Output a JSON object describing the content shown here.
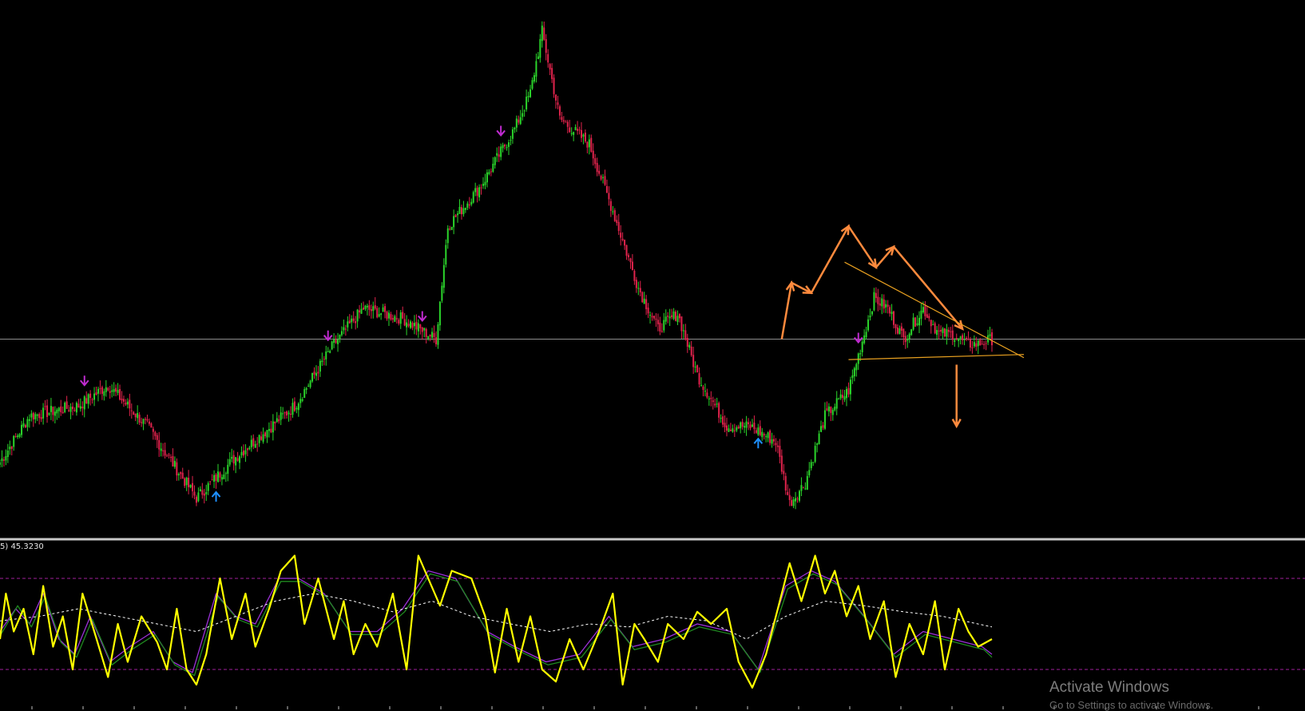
{
  "indicator": {
    "label": "5) 45.3230"
  },
  "watermark": {
    "title": "Activate Windows",
    "subtitle": "Go to Settings to activate Windows."
  },
  "colors": {
    "background": "#000000",
    "bull": "#2bd52b",
    "bear": "#e0234c",
    "horizontal_line": "#8c8c8c",
    "pattern_arrows": "#ff8a3d",
    "triangle_lines": "#e8a020",
    "signal_buy": "#1e90ff",
    "signal_sell": "#c02bd0",
    "oscillator_main": "#ffff00",
    "oscillator_purple": "#9b30d8",
    "oscillator_green": "#1f8a1f",
    "oscillator_dashed": "#ffffff",
    "levels": "#a0209a",
    "separator": "#c0c0c0"
  },
  "chart_data": [
    {
      "type": "candlestick",
      "grid": false,
      "ylim": [
        0,
        100
      ],
      "horizontal_line": 37,
      "close_anchors": [
        [
          0,
          13
        ],
        [
          15,
          22
        ],
        [
          40,
          24
        ],
        [
          55,
          28
        ],
        [
          75,
          20
        ],
        [
          100,
          6
        ],
        [
          120,
          14
        ],
        [
          150,
          24
        ],
        [
          170,
          36
        ],
        [
          185,
          43
        ],
        [
          205,
          41
        ],
        [
          222,
          37
        ],
        [
          228,
          59
        ],
        [
          245,
          67
        ],
        [
          262,
          78
        ],
        [
          270,
          85
        ],
        [
          276,
          97
        ],
        [
          285,
          80
        ],
        [
          300,
          75
        ],
        [
          312,
          62
        ],
        [
          325,
          47
        ],
        [
          335,
          39
        ],
        [
          345,
          42
        ],
        [
          355,
          30
        ],
        [
          370,
          20
        ],
        [
          382,
          20
        ],
        [
          395,
          17
        ],
        [
          402,
          5
        ],
        [
          410,
          9
        ],
        [
          420,
          22
        ],
        [
          432,
          27
        ],
        [
          440,
          38
        ],
        [
          445,
          45
        ],
        [
          452,
          43
        ],
        [
          460,
          37
        ],
        [
          470,
          43
        ],
        [
          478,
          38
        ],
        [
          485,
          38
        ],
        [
          492,
          36
        ],
        [
          498,
          36
        ],
        [
          505,
          37
        ]
      ],
      "bars": 506,
      "signals": [
        {
          "bar": 43,
          "kind": "sell"
        },
        {
          "bar": 110,
          "kind": "buy"
        },
        {
          "bar": 167,
          "kind": "sell"
        },
        {
          "bar": 215,
          "kind": "sell"
        },
        {
          "bar": 255,
          "kind": "sell"
        },
        {
          "bar": 386,
          "kind": "buy"
        },
        {
          "bar": 437,
          "kind": "sell"
        }
      ],
      "pattern": {
        "zigzag": [
          [
            398,
            37
          ],
          [
            403,
            48
          ],
          [
            413,
            46
          ],
          [
            432,
            59
          ],
          [
            446,
            51
          ],
          [
            455,
            55
          ],
          [
            490,
            39
          ]
        ],
        "triangle_upper": [
          [
            430,
            52
          ],
          [
            505,
            34
          ]
        ],
        "triangle_lower": [
          [
            432,
            33
          ],
          [
            505,
            34
          ]
        ],
        "breakout_target": [
          [
            487,
            32
          ],
          [
            487,
            20
          ]
        ]
      }
    },
    {
      "type": "line",
      "title": "",
      "ylim": [
        0,
        100
      ],
      "levels": [
        80,
        20
      ],
      "current_value": 45.323,
      "series": [
        {
          "key": "main",
          "points": [
            [
              0,
              40
            ],
            [
              3,
              70
            ],
            [
              7,
              45
            ],
            [
              12,
              60
            ],
            [
              17,
              30
            ],
            [
              22,
              75
            ],
            [
              27,
              35
            ],
            [
              32,
              55
            ],
            [
              37,
              20
            ],
            [
              42,
              70
            ],
            [
              48,
              45
            ],
            [
              55,
              15
            ],
            [
              60,
              50
            ],
            [
              65,
              25
            ],
            [
              72,
              55
            ],
            [
              80,
              38
            ],
            [
              85,
              20
            ],
            [
              90,
              60
            ],
            [
              95,
              20
            ],
            [
              100,
              10
            ],
            [
              105,
              30
            ],
            [
              112,
              80
            ],
            [
              118,
              40
            ],
            [
              125,
              70
            ],
            [
              130,
              35
            ],
            [
              137,
              60
            ],
            [
              143,
              85
            ],
            [
              150,
              95
            ],
            [
              155,
              50
            ],
            [
              162,
              80
            ],
            [
              170,
              40
            ],
            [
              175,
              65
            ],
            [
              180,
              30
            ],
            [
              186,
              50
            ],
            [
              192,
              35
            ],
            [
              200,
              70
            ],
            [
              207,
              20
            ],
            [
              213,
              95
            ],
            [
              218,
              80
            ],
            [
              224,
              62
            ],
            [
              230,
              85
            ],
            [
              240,
              80
            ],
            [
              247,
              55
            ],
            [
              252,
              18
            ],
            [
              258,
              60
            ],
            [
              264,
              25
            ],
            [
              270,
              55
            ],
            [
              276,
              20
            ],
            [
              283,
              12
            ],
            [
              290,
              40
            ],
            [
              297,
              20
            ],
            [
              305,
              45
            ],
            [
              312,
              70
            ],
            [
              317,
              10
            ],
            [
              323,
              50
            ],
            [
              328,
              40
            ],
            [
              335,
              25
            ],
            [
              340,
              50
            ],
            [
              348,
              40
            ],
            [
              355,
              58
            ],
            [
              362,
              50
            ],
            [
              370,
              60
            ],
            [
              376,
              25
            ],
            [
              383,
              8
            ],
            [
              390,
              30
            ],
            [
              396,
              60
            ],
            [
              402,
              90
            ],
            [
              408,
              65
            ],
            [
              415,
              95
            ],
            [
              420,
              70
            ],
            [
              425,
              85
            ],
            [
              431,
              55
            ],
            [
              437,
              75
            ],
            [
              443,
              40
            ],
            [
              450,
              65
            ],
            [
              456,
              15
            ],
            [
              463,
              50
            ],
            [
              470,
              30
            ],
            [
              476,
              65
            ],
            [
              481,
              20
            ],
            [
              488,
              60
            ],
            [
              493,
              45
            ],
            [
              498,
              35
            ],
            [
              505,
              40
            ]
          ]
        },
        {
          "key": "purple",
          "points": [
            [
              0,
              45
            ],
            [
              8,
              60
            ],
            [
              15,
              50
            ],
            [
              22,
              70
            ],
            [
              30,
              40
            ],
            [
              38,
              30
            ],
            [
              46,
              55
            ],
            [
              56,
              25
            ],
            [
              66,
              35
            ],
            [
              78,
              45
            ],
            [
              88,
              25
            ],
            [
              98,
              18
            ],
            [
              110,
              70
            ],
            [
              120,
              55
            ],
            [
              130,
              50
            ],
            [
              142,
              80
            ],
            [
              152,
              80
            ],
            [
              165,
              70
            ],
            [
              178,
              45
            ],
            [
              192,
              45
            ],
            [
              205,
              60
            ],
            [
              218,
              85
            ],
            [
              232,
              80
            ],
            [
              248,
              45
            ],
            [
              262,
              35
            ],
            [
              278,
              25
            ],
            [
              295,
              30
            ],
            [
              310,
              55
            ],
            [
              322,
              35
            ],
            [
              338,
              40
            ],
            [
              355,
              50
            ],
            [
              372,
              45
            ],
            [
              386,
              20
            ],
            [
              400,
              75
            ],
            [
              413,
              85
            ],
            [
              425,
              78
            ],
            [
              440,
              55
            ],
            [
              455,
              30
            ],
            [
              470,
              45
            ],
            [
              485,
              40
            ],
            [
              500,
              35
            ],
            [
              505,
              30
            ]
          ]
        },
        {
          "key": "green",
          "points": [
            [
              0,
              42
            ],
            [
              9,
              62
            ],
            [
              16,
              48
            ],
            [
              23,
              68
            ],
            [
              31,
              38
            ],
            [
              39,
              28
            ],
            [
              47,
              53
            ],
            [
              57,
              23
            ],
            [
              67,
              33
            ],
            [
              79,
              43
            ],
            [
              89,
              23
            ],
            [
              99,
              16
            ],
            [
              111,
              68
            ],
            [
              121,
              53
            ],
            [
              131,
              48
            ],
            [
              143,
              78
            ],
            [
              153,
              78
            ],
            [
              166,
              68
            ],
            [
              179,
              43
            ],
            [
              193,
              43
            ],
            [
              206,
              58
            ],
            [
              219,
              83
            ],
            [
              233,
              78
            ],
            [
              249,
              43
            ],
            [
              263,
              33
            ],
            [
              279,
              23
            ],
            [
              296,
              28
            ],
            [
              311,
              53
            ],
            [
              323,
              33
            ],
            [
              339,
              38
            ],
            [
              356,
              48
            ],
            [
              373,
              43
            ],
            [
              387,
              18
            ],
            [
              401,
              73
            ],
            [
              414,
              83
            ],
            [
              426,
              76
            ],
            [
              441,
              53
            ],
            [
              456,
              28
            ],
            [
              471,
              43
            ],
            [
              486,
              38
            ],
            [
              501,
              33
            ],
            [
              505,
              28
            ]
          ]
        },
        {
          "key": "dashed",
          "points": [
            [
              0,
              52
            ],
            [
              20,
              55
            ],
            [
              40,
              60
            ],
            [
              60,
              55
            ],
            [
              80,
              50
            ],
            [
              100,
              45
            ],
            [
              120,
              55
            ],
            [
              140,
              65
            ],
            [
              160,
              70
            ],
            [
              180,
              65
            ],
            [
              200,
              58
            ],
            [
              220,
              65
            ],
            [
              240,
              55
            ],
            [
              260,
              50
            ],
            [
              280,
              45
            ],
            [
              300,
              50
            ],
            [
              320,
              48
            ],
            [
              340,
              55
            ],
            [
              360,
              52
            ],
            [
              380,
              40
            ],
            [
              400,
              55
            ],
            [
              420,
              65
            ],
            [
              440,
              62
            ],
            [
              460,
              58
            ],
            [
              480,
              55
            ],
            [
              505,
              48
            ]
          ]
        }
      ]
    }
  ]
}
